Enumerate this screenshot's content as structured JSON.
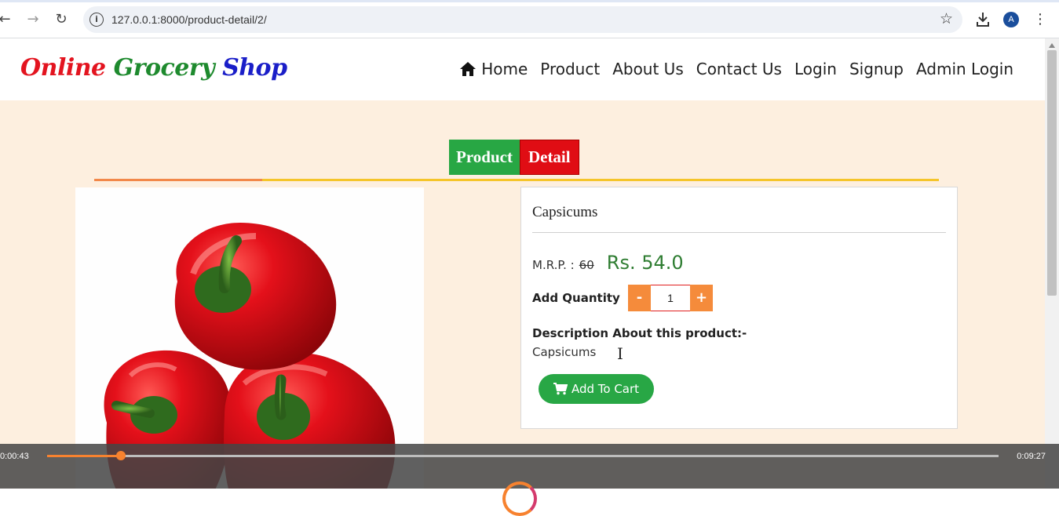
{
  "browser": {
    "url": "127.0.0.1:8000/product-detail/2/",
    "avatar_letter": "A",
    "icons": [
      "back-icon",
      "forward-icon",
      "reload-icon",
      "site-info-icon",
      "bookmark-star-icon",
      "download-icon",
      "menu-kebab-icon"
    ]
  },
  "site": {
    "brand": {
      "word1": "Online",
      "word2": "Grocery",
      "word3": "Shop"
    },
    "nav": [
      "Home",
      "Product",
      "About Us",
      "Contact Us",
      "Login",
      "Signup",
      "Admin Login"
    ],
    "colors": {
      "brand_red": "#e3141f",
      "brand_green": "#1e8a2e",
      "brand_blue": "#1a1ec8",
      "page_bg": "#fdefdf"
    }
  },
  "section": {
    "title_part1": "Product",
    "title_part2": "Detail"
  },
  "product": {
    "name": "Capsicums",
    "mrp_label": "M.R.P. :",
    "mrp": "60",
    "price": "Rs. 54.0",
    "quantity_label": "Add Quantity",
    "minus": "-",
    "quantity": "1",
    "plus": "+",
    "description_title": "Description About this product:-",
    "description": "Capsicums",
    "add_to_cart": "Add To Cart"
  },
  "player": {
    "current_time": "0:00:43",
    "total_time": "0:09:27",
    "progress": 0.0776
  }
}
